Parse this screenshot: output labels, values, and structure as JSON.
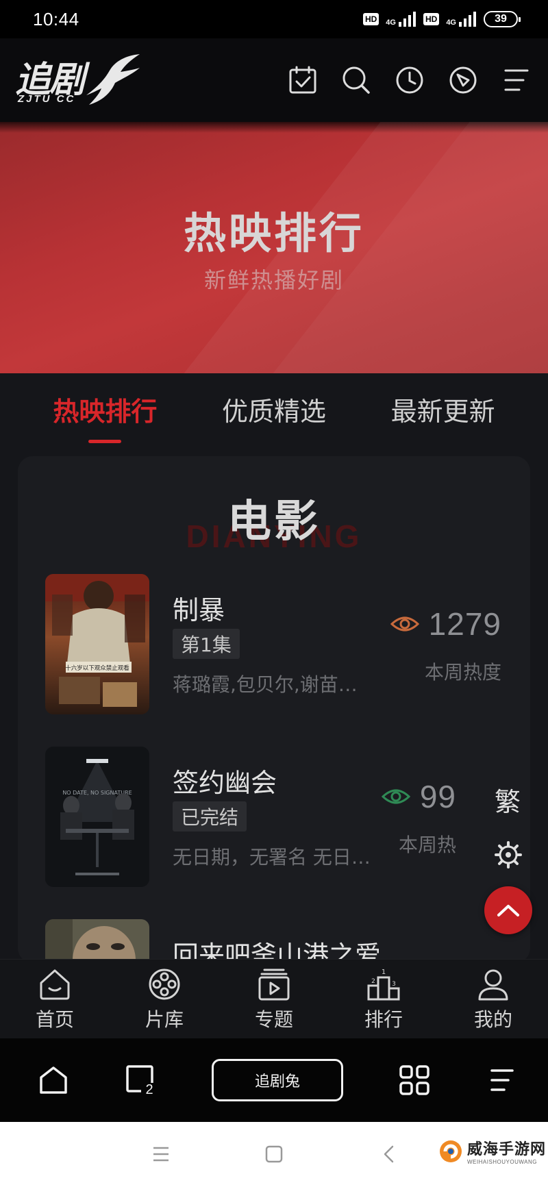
{
  "status_bar": {
    "time": "10:44",
    "hd_label": "HD",
    "network_label": "4G",
    "battery": "39"
  },
  "header": {
    "logo_text": "追剧",
    "logo_sub": "ZJTU CC",
    "icons": [
      "calendar-check-icon",
      "search-icon",
      "clock-icon",
      "compass-icon",
      "menu-icon"
    ]
  },
  "banner": {
    "title": "热映排行",
    "subtitle": "新鲜热播好剧"
  },
  "tabs": [
    {
      "label": "热映排行",
      "active": true
    },
    {
      "label": "优质精选",
      "active": false
    },
    {
      "label": "最新更新",
      "active": false
    }
  ],
  "section": {
    "title": "电影",
    "bg_text": "DIANYING"
  },
  "items": [
    {
      "title": "制暴",
      "badge": "第1集",
      "cast": "蒋璐霞,包贝尔,谢苗…",
      "views": "1279",
      "views_label": "本周热度",
      "eye_color": "#c86a3c",
      "poster_text": "十六岁以下观众禁止观看"
    },
    {
      "title": "签约幽会",
      "badge": "已完结",
      "cast": "无日期，无署名 无日…",
      "views": "99",
      "views_label": "本周热",
      "eye_color": "#2f8a55",
      "poster_text": "NO DATE, NO SIGNATURE"
    },
    {
      "title": "回来吧釜山港之爱"
    }
  ],
  "floating": {
    "traditional_label": "繁"
  },
  "bottom_nav": [
    {
      "label": "首页",
      "icon": "home-icon"
    },
    {
      "label": "片库",
      "icon": "film-reel-icon"
    },
    {
      "label": "专题",
      "icon": "topic-play-icon"
    },
    {
      "label": "排行",
      "icon": "podium-icon"
    },
    {
      "label": "我的",
      "icon": "user-icon"
    }
  ],
  "browser_bar": {
    "center_label": "追剧兔",
    "tabs_count": "2"
  },
  "watermark": {
    "main": "威海手游网",
    "sub": "WEIHAISHOUYOUWANG"
  },
  "colors": {
    "accent": "#d8262a",
    "banner": "#b83235",
    "background": "#15161a"
  }
}
